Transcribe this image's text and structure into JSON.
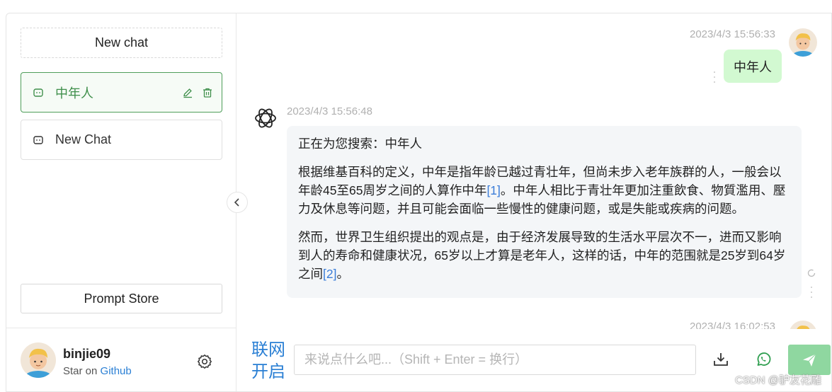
{
  "sidebar": {
    "new_chat_label": "New chat",
    "conversations": [
      {
        "label": "中年人",
        "active": true
      },
      {
        "label": "New Chat",
        "active": false
      }
    ],
    "prompt_store_label": "Prompt Store",
    "user": {
      "name": "binjie09",
      "star_prefix": "Star on",
      "star_link": "Github"
    }
  },
  "chat": {
    "messages": [
      {
        "role": "user",
        "time": "2023/4/3 15:56:33",
        "text": "中年人"
      },
      {
        "role": "assistant",
        "time": "2023/4/3 15:56:48",
        "p1": "正在为您搜索：中年人",
        "p2a": "根据维基百科的定义，中年是指年龄已越过青壮年，但尚未步入老年族群的人，一般会以年龄45至65周岁之间的人算作中年",
        "p2cite": "[1]",
        "p2b": "。中年人相比于青壮年更加注重飲食、物質濫用、壓力及休息等问题，并且可能会面临一些慢性的健康问题，或是失能或疾病的问题。",
        "p3a": "然而，世界卫生组织提出的观点是，由于经济发展导致的生活水平层次不一，进而又影响到人的寿命和健康状况，65岁以上才算是老年人，这样的话，中年的范围就是25岁到64岁之间",
        "p3cite": "[2]",
        "p3b": "。"
      },
      {
        "role": "user",
        "time": "2023/4/3 16:02:53"
      }
    ],
    "network_toggle": [
      "联网",
      "开启"
    ],
    "input_placeholder": "来说点什么吧...（Shift + Enter = 换行）"
  },
  "watermark": "CSDN @驴友花雕",
  "colors": {
    "accent_green": "#4f9e5a",
    "user_bubble": "#d2f9d1",
    "send_button": "#8fd7a0",
    "link": "#2a7fd4"
  }
}
